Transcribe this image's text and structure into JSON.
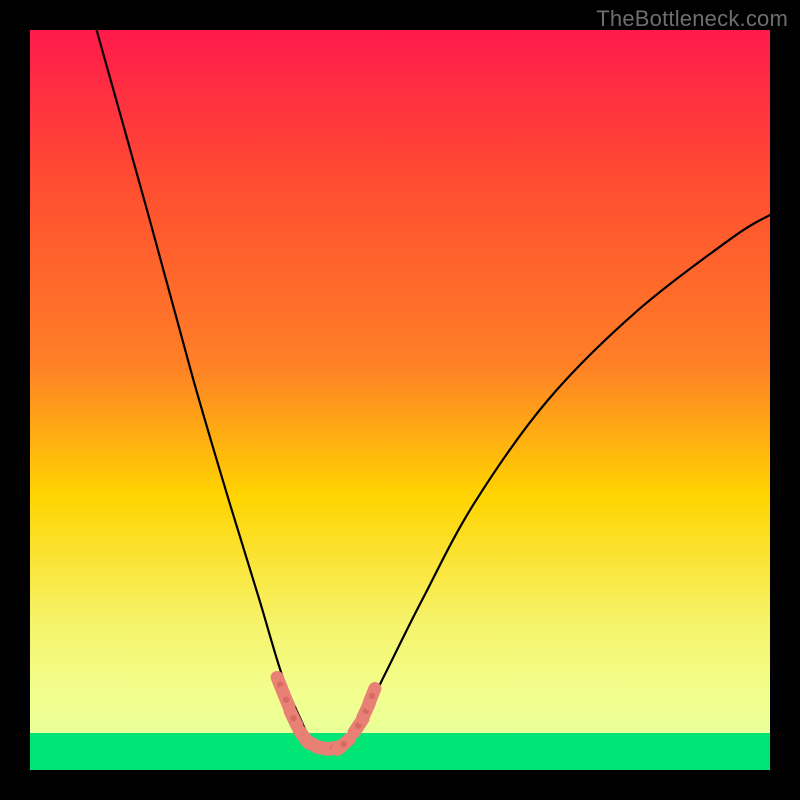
{
  "watermark": "TheBottleneck.com",
  "chart_data": {
    "type": "line",
    "title": "",
    "xlabel": "",
    "ylabel": "",
    "xlim": [
      0,
      100
    ],
    "ylim": [
      0,
      100
    ],
    "background_gradient": {
      "top": "#ff1a4b",
      "upper_mid": "#ff7f27",
      "mid": "#ffd400",
      "lower_mid": "#f6f36a",
      "near_bottom": "#e8ff9a",
      "bottom": "#00e676"
    },
    "curve": {
      "description": "V-shaped bottleneck curve",
      "points_xy": [
        [
          9,
          100
        ],
        [
          16,
          75
        ],
        [
          22,
          53
        ],
        [
          27,
          36
        ],
        [
          31,
          23
        ],
        [
          34,
          13
        ],
        [
          36.5,
          7
        ],
        [
          38,
          4
        ],
        [
          39.5,
          3
        ],
        [
          41.5,
          3
        ],
        [
          43,
          4
        ],
        [
          45,
          7
        ],
        [
          48,
          13
        ],
        [
          53,
          23
        ],
        [
          60,
          36
        ],
        [
          70,
          50
        ],
        [
          82,
          62
        ],
        [
          95,
          72
        ],
        [
          100,
          75
        ]
      ]
    },
    "markers": {
      "color": "#e98076",
      "points_xy": [
        [
          33.8,
          11.5
        ],
        [
          34.6,
          9.5
        ],
        [
          35.6,
          7.0
        ],
        [
          37.0,
          4.5
        ],
        [
          38.2,
          3.5
        ],
        [
          39.6,
          3.0
        ],
        [
          41.0,
          3.0
        ],
        [
          42.4,
          3.5
        ],
        [
          44.4,
          6.0
        ],
        [
          45.4,
          8.0
        ],
        [
          46.2,
          10.0
        ]
      ]
    },
    "baseline_band": {
      "y_top": 5,
      "y_bottom": 0,
      "color": "#00e676"
    }
  }
}
